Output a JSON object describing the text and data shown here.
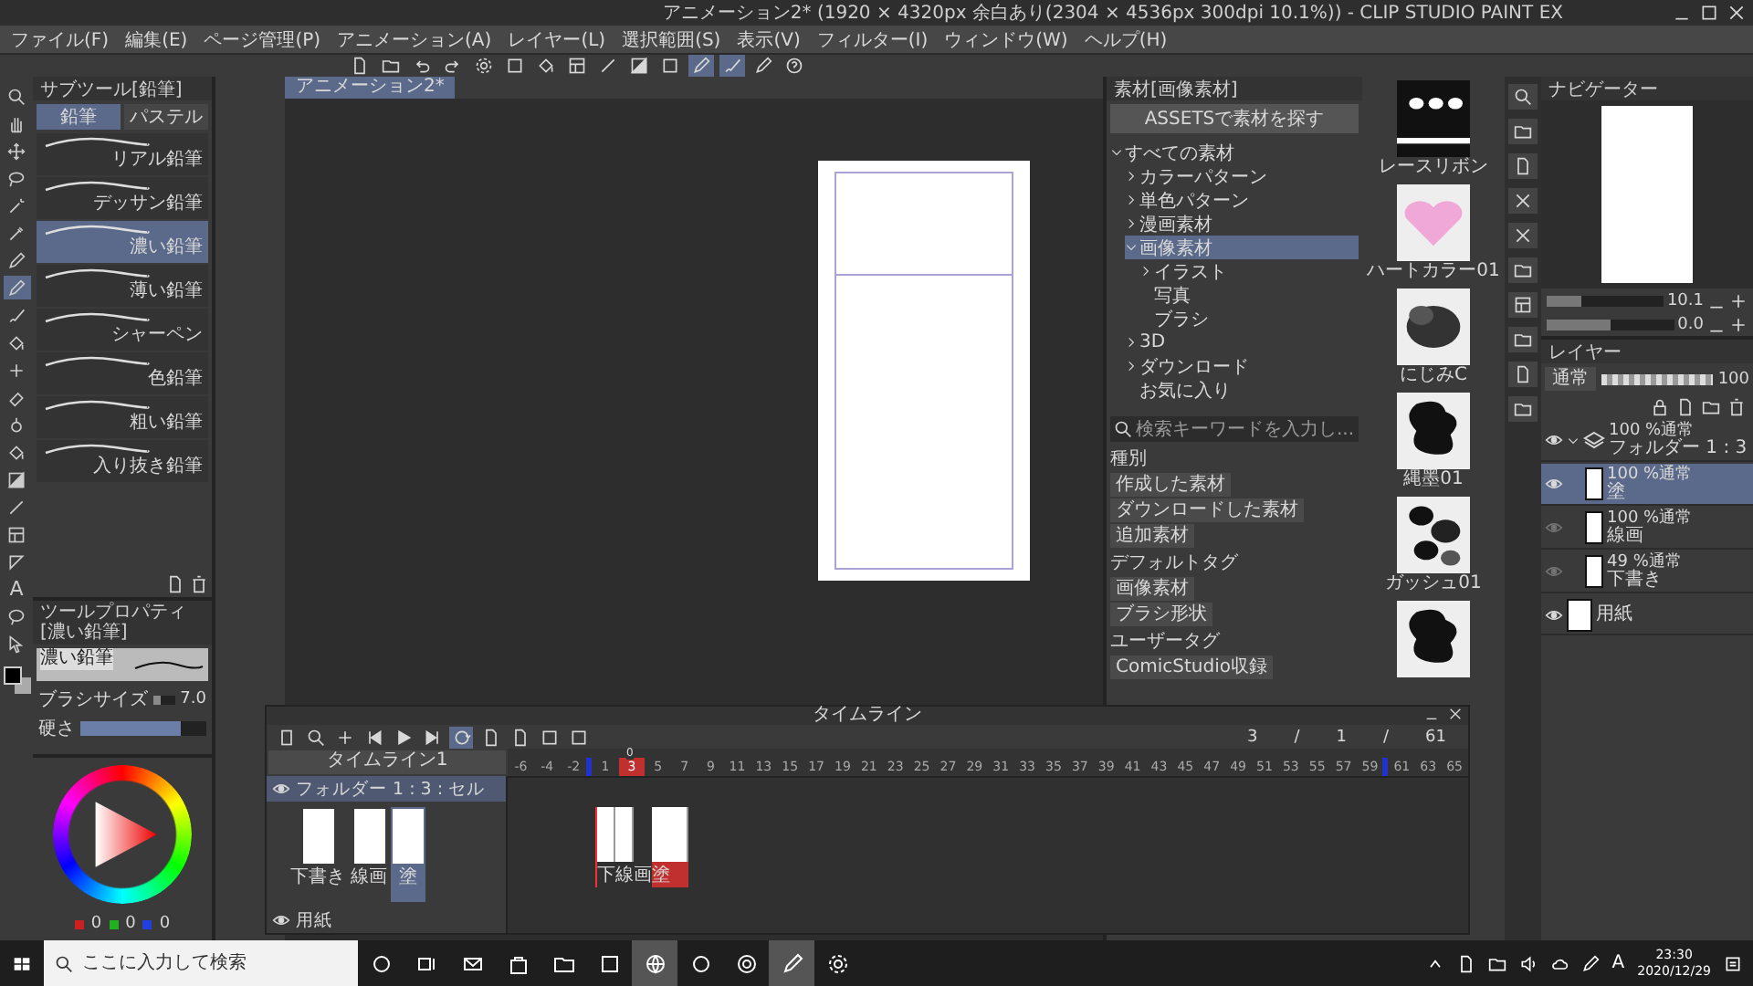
{
  "window": {
    "title": "アニメーション2* (1920 × 4320px 余白あり(2304 × 4536px 300dpi 10.1%)) - CLIP STUDIO PAINT EX"
  },
  "menu": [
    "ファイル(F)",
    "編集(E)",
    "ページ管理(P)",
    "アニメーション(A)",
    "レイヤー(L)",
    "選択範囲(S)",
    "表示(V)",
    "フィルター(I)",
    "ウィンドウ(W)",
    "ヘルプ(H)"
  ],
  "toolbar": [
    {
      "kind": "document",
      "selected": false
    },
    {
      "kind": "folder",
      "selected": false
    },
    {
      "kind": "undo",
      "selected": false
    },
    {
      "kind": "redo",
      "selected": false
    },
    {
      "kind": "gear",
      "selected": false
    },
    {
      "kind": "square",
      "selected": false
    },
    {
      "kind": "bucket",
      "selected": false
    },
    {
      "kind": "frame",
      "selected": false
    },
    {
      "kind": "line",
      "selected": false
    },
    {
      "kind": "gradient",
      "selected": false
    },
    {
      "kind": "square",
      "selected": false
    },
    {
      "kind": "pen",
      "selected": true
    },
    {
      "kind": "brush",
      "selected": true
    },
    {
      "kind": "pen",
      "selected": false
    },
    {
      "kind": "help",
      "selected": false
    }
  ],
  "tools": [
    {
      "kind": "magnifier",
      "selected": false
    },
    {
      "kind": "hand",
      "selected": false
    },
    {
      "kind": "arrows",
      "selected": false
    },
    {
      "kind": "lasso",
      "selected": false
    },
    {
      "kind": "wand",
      "selected": false
    },
    {
      "kind": "dropper",
      "selected": false
    },
    {
      "kind": "pen",
      "selected": false
    },
    {
      "kind": "pen",
      "selected": true
    },
    {
      "kind": "brush",
      "selected": false
    },
    {
      "kind": "bucket",
      "selected": false
    },
    {
      "kind": "plus",
      "selected": false
    },
    {
      "kind": "eraser",
      "selected": false
    },
    {
      "kind": "blur",
      "selected": false
    },
    {
      "kind": "bucket",
      "selected": false
    },
    {
      "kind": "gradient",
      "selected": false
    },
    {
      "kind": "line",
      "selected": false
    },
    {
      "kind": "frame",
      "selected": false
    },
    {
      "kind": "triangle",
      "selected": false
    },
    {
      "kind": "text",
      "glyph": "A",
      "selected": false
    },
    {
      "kind": "balloon",
      "selected": false
    },
    {
      "kind": "pointer",
      "selected": false
    }
  ],
  "subtool": {
    "title": "サブツール[鉛筆]",
    "tabs": [
      {
        "label": "鉛筆",
        "selected": true
      },
      {
        "label": "パステル",
        "selected": false
      }
    ],
    "brushes": [
      {
        "label": "リアル鉛筆",
        "selected": false
      },
      {
        "label": "デッサン鉛筆",
        "selected": false
      },
      {
        "label": "濃い鉛筆",
        "selected": true
      },
      {
        "label": "薄い鉛筆",
        "selected": false
      },
      {
        "label": "シャーペン",
        "selected": false
      },
      {
        "label": "色鉛筆",
        "selected": false
      },
      {
        "label": "粗い鉛筆",
        "selected": false
      },
      {
        "label": "入り抜き鉛筆",
        "selected": false
      }
    ]
  },
  "tool_property": {
    "title": "ツールプロパティ[濃い鉛筆]",
    "preview_label": "濃い鉛筆",
    "brush_size": {
      "label": "ブラシサイズ",
      "value": "7.0",
      "level": 0.3
    },
    "hardness": {
      "label": "硬さ",
      "level": 0.8
    }
  },
  "color": {
    "channels": [
      {
        "color": "#cc2020",
        "value": "0"
      },
      {
        "color": "#20b020",
        "value": "0"
      },
      {
        "color": "#2040e0",
        "value": "0"
      }
    ]
  },
  "canvas": {
    "tab": "アニメーション2*"
  },
  "materials": {
    "title": "素材[画像素材]",
    "assets_button": "ASSETSで素材を探す",
    "tree": [
      {
        "label": "すべての素材",
        "expanded": true,
        "selected": false,
        "children": [
          {
            "label": "カラーパターン",
            "expanded": false,
            "selected": false
          },
          {
            "label": "単色パターン",
            "expanded": false,
            "selected": false
          },
          {
            "label": "漫画素材",
            "expanded": false,
            "selected": false
          },
          {
            "label": "画像素材",
            "expanded": true,
            "selected": true,
            "children": [
              {
                "label": "イラスト",
                "expanded": false,
                "selected": false
              },
              {
                "label": "写真",
                "selected": false
              },
              {
                "label": "ブラシ",
                "selected": false
              }
            ]
          },
          {
            "label": "3D",
            "expanded": false,
            "selected": false
          },
          {
            "label": "ダウンロード",
            "expanded": false,
            "selected": false
          },
          {
            "label": "お気に入り",
            "selected": false
          }
        ]
      }
    ],
    "search_placeholder": "検索キーワードを入力し...",
    "tag_groups": [
      {
        "heading": "種別",
        "tags": [
          "作成した素材",
          "ダウンロードした素材",
          "追加素材"
        ]
      },
      {
        "heading": "デフォルトタグ",
        "tags": [
          "画像素材",
          "ブラシ形状"
        ]
      },
      {
        "heading": "ユーザータグ",
        "tags": [
          "ComicStudio収録"
        ]
      }
    ],
    "thumbnails": [
      {
        "kind": "lace",
        "label": "レースリボン"
      },
      {
        "kind": "heart",
        "label": "ハートカラー01"
      },
      {
        "kind": "blot",
        "label": "にじみC"
      },
      {
        "kind": "splat",
        "label": "縄墨01"
      },
      {
        "kind": "gouache",
        "label": "ガッシュ01"
      },
      {
        "kind": "splat"
      }
    ]
  },
  "navigator": {
    "title": "ナビゲーター",
    "zoom": {
      "value": "10.1",
      "level": 0.3
    },
    "rotation": {
      "value": "0.0",
      "level": 0.5
    }
  },
  "layers": {
    "title": "レイヤー",
    "blend_mode": "通常",
    "opacity": {
      "value": "100",
      "level": 1
    },
    "items": [
      {
        "kind": "folder",
        "mode": "100 %通常",
        "name": "フォルダー 1 : 3",
        "visible": true,
        "selected": false,
        "expanded": true,
        "children": [
          {
            "kind": "raster",
            "mode": "100 %通常",
            "name": "塗",
            "visible": true,
            "selected": true
          },
          {
            "kind": "raster",
            "mode": "100 %通常",
            "name": "線画",
            "visible": false,
            "selected": false
          },
          {
            "kind": "raster",
            "mode": "49 %通常",
            "name": "下書き",
            "visible": false,
            "selected": false
          }
        ]
      },
      {
        "kind": "paper",
        "name": "用紙",
        "visible": true,
        "selected": false
      }
    ]
  },
  "timeline": {
    "title": "タイムライン",
    "name": "タイムライン1",
    "counter": [
      "3",
      "/",
      "1",
      "/",
      "61"
    ],
    "start_label": "0",
    "ruler": [
      {
        "label": "-6",
        "selected": false
      },
      {
        "label": "-4",
        "selected": false
      },
      {
        "label": "-2",
        "selected": false
      },
      {
        "label": "1",
        "selected": false,
        "edge": true
      },
      {
        "label": "3",
        "selected": true
      },
      {
        "label": "5",
        "selected": false
      },
      {
        "label": "7",
        "selected": false
      },
      {
        "label": "9",
        "selected": false
      },
      {
        "label": "11",
        "selected": false
      },
      {
        "label": "13",
        "selected": false
      },
      {
        "label": "15",
        "selected": false
      },
      {
        "label": "17",
        "selected": false
      },
      {
        "label": "19",
        "selected": false
      },
      {
        "label": "21",
        "selected": false
      },
      {
        "label": "23",
        "selected": false
      },
      {
        "label": "25",
        "selected": false
      },
      {
        "label": "27",
        "selected": false
      },
      {
        "label": "29",
        "selected": false
      },
      {
        "label": "31",
        "selected": false
      },
      {
        "label": "33",
        "selected": false
      },
      {
        "label": "35",
        "selected": false
      },
      {
        "label": "37",
        "selected": false
      },
      {
        "label": "39",
        "selected": false
      },
      {
        "label": "41",
        "selected": false
      },
      {
        "label": "43",
        "selected": false
      },
      {
        "label": "45",
        "selected": false
      },
      {
        "label": "47",
        "selected": false
      },
      {
        "label": "49",
        "selected": false
      },
      {
        "label": "51",
        "selected": false
      },
      {
        "label": "53",
        "selected": false
      },
      {
        "label": "55",
        "selected": false
      },
      {
        "label": "57",
        "selected": false
      },
      {
        "label": "59",
        "selected": false
      },
      {
        "label": "61",
        "selected": false,
        "edge": true
      },
      {
        "label": "63",
        "selected": false
      },
      {
        "label": "65",
        "selected": false
      }
    ],
    "folder_track": {
      "name": "フォルダー 1 : 3 : セル",
      "cells": [
        {
          "label": "下書き",
          "selected": false
        },
        {
          "label": "線画",
          "selected": false
        },
        {
          "label": "塗",
          "selected": true
        }
      ],
      "frame_cells": [
        {
          "label": "下",
          "selected": false
        },
        {
          "label": "線画",
          "selected": false
        },
        {
          "label": "塗",
          "selected": true
        }
      ]
    },
    "paper_track": {
      "name": "用紙"
    }
  },
  "taskbar": {
    "search_placeholder": "ここに入力して検索",
    "apps": [
      {
        "kind": "circle",
        "active": false
      },
      {
        "kind": "taskview",
        "active": false
      },
      {
        "kind": "mail",
        "active": false
      },
      {
        "kind": "bag",
        "active": false
      },
      {
        "kind": "folder",
        "active": false
      },
      {
        "kind": "square",
        "active": false
      },
      {
        "kind": "globe",
        "active": true
      },
      {
        "kind": "circle",
        "active": false
      },
      {
        "kind": "ring",
        "active": false
      },
      {
        "kind": "pen",
        "active": true
      },
      {
        "kind": "gear",
        "active": false
      }
    ],
    "ime": "A",
    "time": "23:30",
    "date": "2020/12/29"
  }
}
